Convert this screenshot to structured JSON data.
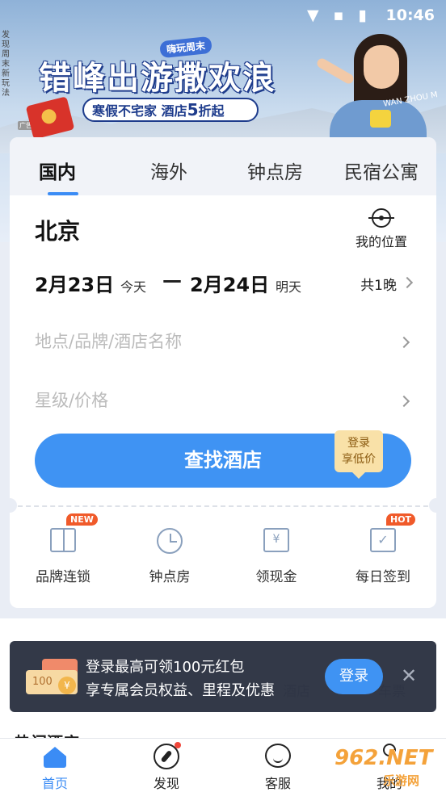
{
  "status_bar": {
    "time": "10:46",
    "icons": "▼ ▪ ▮"
  },
  "banner": {
    "side_text": "发现周末新玩法",
    "ad_tag": "广告",
    "ribbon": "嗨玩周末",
    "headline": "错峰出游撒欢浪",
    "promo": "寒假不宅家 酒店5折起",
    "promo_part1": "寒假不宅家 酒店",
    "promo_part2": "5",
    "promo_part3": "折起",
    "side_brand": "WAN ZHOU M"
  },
  "tabs": [
    {
      "label": "国内",
      "active": true
    },
    {
      "label": "海外",
      "active": false
    },
    {
      "label": "钟点房",
      "active": false
    },
    {
      "label": "民宿公寓",
      "active": false
    }
  ],
  "search": {
    "city": "北京",
    "my_location": "我的位置",
    "checkin_date": "2月23日",
    "checkin_note": "今天",
    "separator": "—",
    "checkout_date": "2月24日",
    "checkout_note": "明天",
    "nights": "共1晚",
    "keyword_placeholder": "地点/品牌/酒店名称",
    "star_price_placeholder": "星级/价格",
    "search_button": "查找酒店",
    "login_tag_line1": "登录",
    "login_tag_line2": "享低价"
  },
  "quick_links": [
    {
      "label": "品牌连锁",
      "icon": "store-icon",
      "badge": "NEW"
    },
    {
      "label": "钟点房",
      "icon": "clock-icon",
      "badge": ""
    },
    {
      "label": "领现金",
      "icon": "wallet-icon",
      "badge": ""
    },
    {
      "label": "每日签到",
      "icon": "calendar-check-icon",
      "badge": "HOT"
    }
  ],
  "ghost_labels": [
    "酒店",
    "车票"
  ],
  "section_title": "热门酒店",
  "login_toast": {
    "line1": "登录最高可领100元红包",
    "line2": "享专属会员权益、里程及优惠",
    "button": "登录",
    "close": "✕",
    "image_text": "100",
    "coin": "¥"
  },
  "bottom_nav": [
    {
      "label": "首页",
      "icon": "home-icon",
      "active": true
    },
    {
      "label": "发现",
      "icon": "compass-icon",
      "active": false
    },
    {
      "label": "客服",
      "icon": "chat-icon",
      "active": false
    },
    {
      "label": "我的",
      "icon": "user-icon",
      "active": false
    }
  ],
  "watermark": {
    "top": "962.NET",
    "bottom": "乐游网"
  },
  "colors": {
    "accent": "#3f93f3",
    "badge": "#f05a2a",
    "toast_bg": "#222838",
    "tag_bg": "#f9e1a8"
  }
}
